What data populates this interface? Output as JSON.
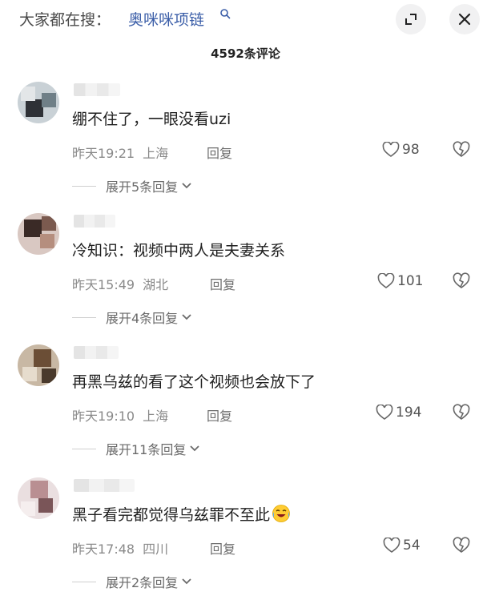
{
  "topbar": {
    "search_prefix": "大家都在搜：",
    "search_term": "奥咪咪项链"
  },
  "comment_count": "4592条评论",
  "comments": [
    {
      "text": "绷不住了，一眼没看uzi",
      "time": "昨天19:21",
      "location": "上海",
      "reply_label": "回复",
      "likes": "98",
      "expand_label": "展开5条回复"
    },
    {
      "text": "冷知识：视频中两人是夫妻关系",
      "time": "昨天15:49",
      "location": "湖北",
      "reply_label": "回复",
      "likes": "101",
      "expand_label": "展开4条回复"
    },
    {
      "text": "再黑乌兹的看了这个视频也会放下了",
      "time": "昨天19:10",
      "location": "上海",
      "reply_label": "回复",
      "likes": "194",
      "expand_label": "展开11条回复"
    },
    {
      "text": "黑子看完都觉得乌兹罪不至此",
      "time": "昨天17:48",
      "location": "四川",
      "reply_label": "回复",
      "likes": "54",
      "expand_label": "展开2条回复",
      "emoji": "crying-laughing-emoji"
    }
  ],
  "icons": {
    "search": "search-icon",
    "expand": "fullscreen-icon",
    "close": "close-icon",
    "like": "heart-icon",
    "dislike": "broken-heart-icon",
    "chevron": "chevron-down-icon"
  },
  "colors": {
    "search_term": "#3b5ea8",
    "meta_text": "#8a8a8a",
    "button_bg": "#f1f1f2"
  }
}
